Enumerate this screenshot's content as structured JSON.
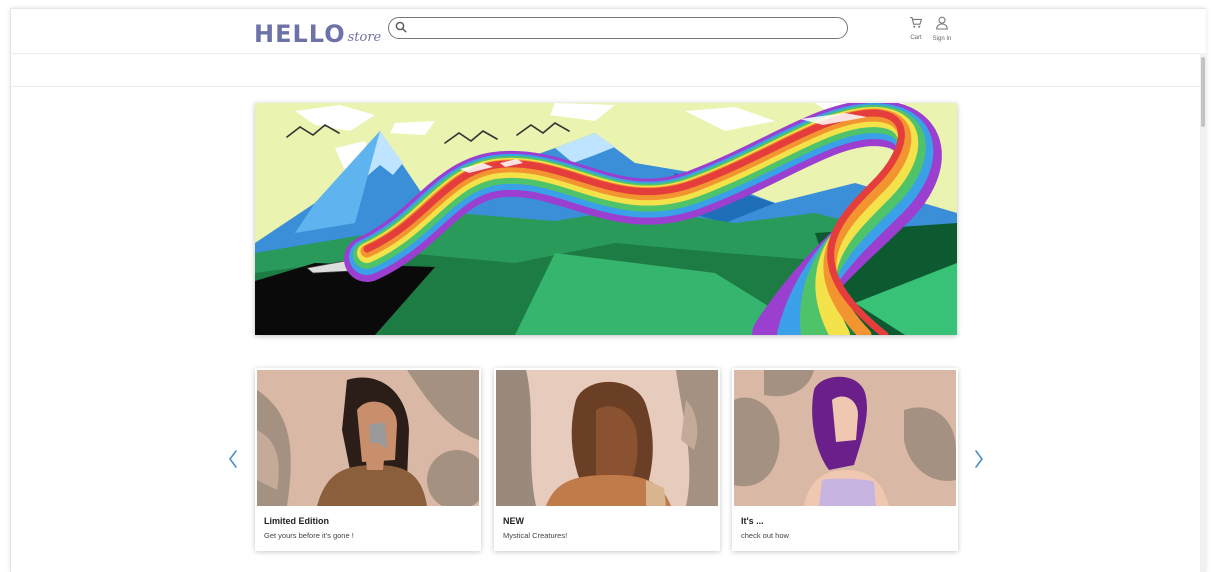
{
  "header": {
    "logo_main": "HELLO",
    "logo_sub": "store",
    "search_placeholder": "",
    "search_value": "",
    "cart_label": "Cart",
    "signin_label": "Sign In"
  },
  "icons": {
    "search": "search-icon",
    "cart": "cart-icon",
    "user": "user-icon",
    "prev": "chevron-left-icon",
    "next": "chevron-right-icon"
  },
  "colors": {
    "brand": "#6d73a8",
    "arrow": "#4a90c8"
  },
  "cards": [
    {
      "title": "Limited Edition",
      "description": "Get yours before it's gone !"
    },
    {
      "title": "NEW",
      "description": "Mystical Creatures!"
    },
    {
      "title": "It's ...",
      "description": "check out how"
    }
  ]
}
